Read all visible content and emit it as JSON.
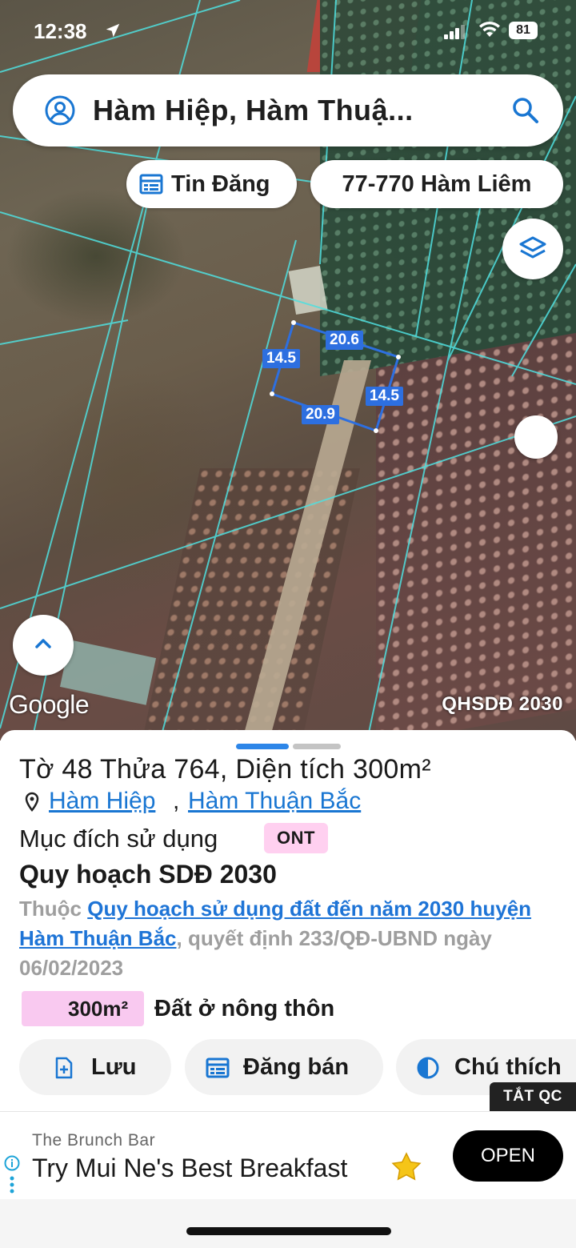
{
  "status_bar": {
    "time": "12:38",
    "battery": "81"
  },
  "search": {
    "query": "Hàm Hiệp, Hàm Thuậ..."
  },
  "chips": {
    "listing": "Tin Đăng",
    "address": "77-770 Hàm Liêm"
  },
  "parcel": {
    "top": "20.6",
    "left": "14.5",
    "right": "14.5",
    "bottom": "20.9"
  },
  "map": {
    "attribution": "Google",
    "layer_label": "QHSDĐ 2030"
  },
  "sheet": {
    "title": "Tờ 48 Thửa 764, Diện tích 300m²",
    "location_commune": "Hàm Hiệp",
    "location_sep": ",",
    "location_district": "Hàm Thuận Bắc",
    "purpose_label": "Mục đích sử dụng",
    "purpose_code": "ONT",
    "plan_heading": "Quy hoạch SDĐ 2030",
    "plan_prefix": "Thuộc ",
    "plan_link": "Quy hoạch sử dụng đất đến năm 2030 huyện Hàm Thuận Bắc",
    "plan_suffix": ", quyết định 233/QĐ-UBND ngày 06/02/2023",
    "area_value": "300m²",
    "area_label": "Đất ở nông thôn",
    "actions": {
      "save": "Lưu",
      "post": "Đăng bán",
      "legend": "Chú thích"
    },
    "ad_off": "TẮT QC"
  },
  "ad": {
    "source": "The Brunch Bar",
    "headline": "Try Mui Ne's Best Breakfast",
    "cta": "OPEN"
  },
  "colors": {
    "accent": "#1976d2",
    "ont_badge": "#ffd0f0",
    "area_badge": "#f9c9f0"
  }
}
